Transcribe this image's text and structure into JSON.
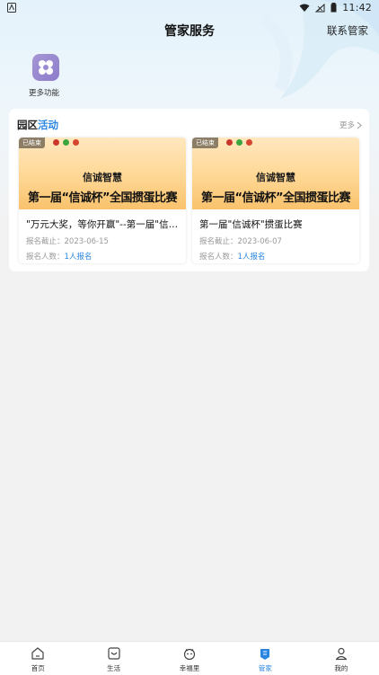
{
  "status_bar": {
    "time": "11:42"
  },
  "header": {
    "title": "管家服务",
    "action": "联系管家"
  },
  "quick_actions": [
    {
      "label": "更多功能",
      "icon": "grid-icon"
    }
  ],
  "activity": {
    "title_part1": "园区",
    "title_part2": "活动",
    "more": "更多",
    "events": [
      {
        "badge": "已结束",
        "org_text": "信诚智慧",
        "headline": "第一届“信诚杯”全国掼蛋比赛",
        "title": "\"万元大奖，等你开赢\"--第一届\"信诚杯\"掼蛋比赛",
        "deadline_label": "报名截止：",
        "deadline": "2023-06-15",
        "signup_label": "报名人数：",
        "signup_count": "1人报名"
      },
      {
        "badge": "已结束",
        "org_text": "信诚智慧",
        "headline": "第一届“信诚杯”全国掼蛋比赛",
        "title": "第一届\"信诚杯\"掼蛋比赛",
        "deadline_label": "报名截止：",
        "deadline": "2023-06-07",
        "signup_label": "报名人数：",
        "signup_count": "1人报名"
      }
    ]
  },
  "tabs": [
    {
      "label": "首页",
      "icon": "home-icon",
      "active": false
    },
    {
      "label": "生活",
      "icon": "life-icon",
      "active": false
    },
    {
      "label": "幸福里",
      "icon": "happiness-icon",
      "active": false
    },
    {
      "label": "管家",
      "icon": "steward-icon",
      "active": true
    },
    {
      "label": "我的",
      "icon": "profile-icon",
      "active": false
    }
  ],
  "colors": {
    "accent": "#2a86e0",
    "banner": "#ffd794",
    "quick_icon": "#9a8bd1"
  }
}
